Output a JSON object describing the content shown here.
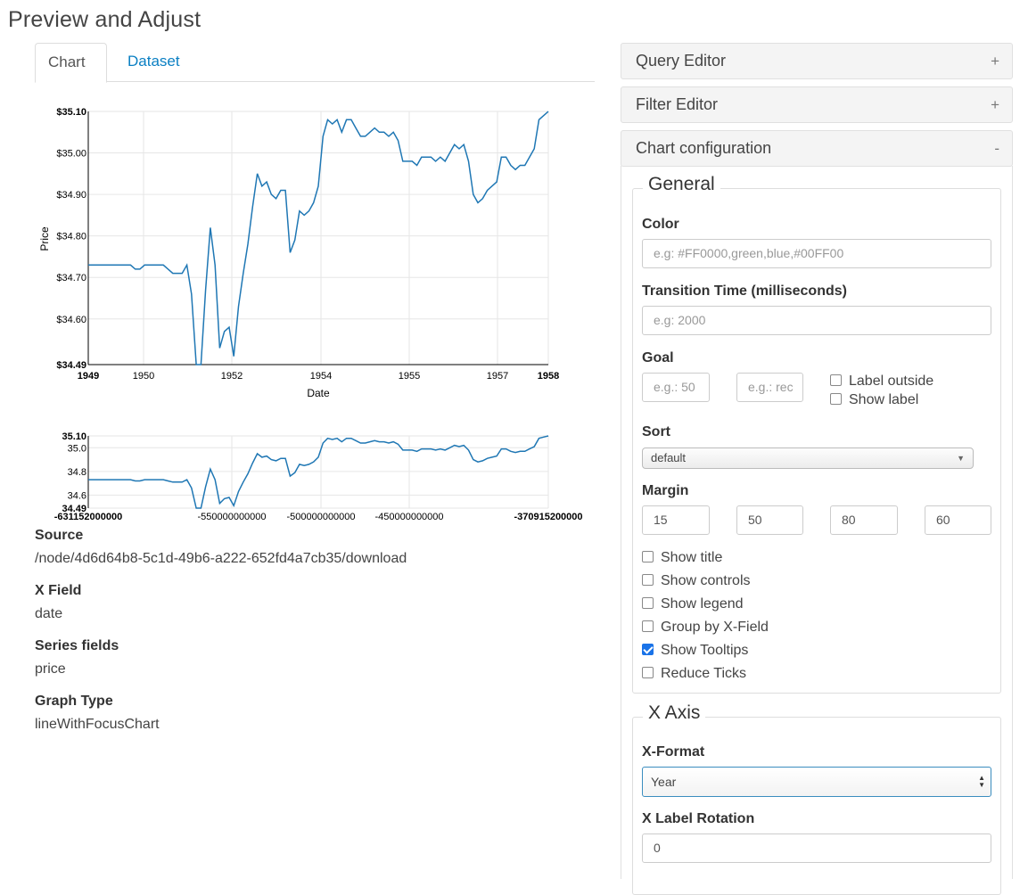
{
  "page_title": "Preview and Adjust",
  "tabs": {
    "chart": "Chart",
    "dataset": "Dataset"
  },
  "info": {
    "source_label": "Source",
    "source_value": "/node/4d6d64b8-5c1d-49b6-a222-652fd4a7cb35/download",
    "xfield_label": "X Field",
    "xfield_value": "date",
    "series_label": "Series fields",
    "series_value": "price",
    "graph_label": "Graph Type",
    "graph_value": "lineWithFocusChart"
  },
  "panels": {
    "query": {
      "title": "Query Editor",
      "toggle": "+"
    },
    "filter": {
      "title": "Filter Editor",
      "toggle": "+"
    },
    "chartcfg": {
      "title": "Chart configuration",
      "toggle": "-"
    }
  },
  "general": {
    "legend": "General",
    "color_label": "Color",
    "color_placeholder": "e.g: #FF0000,green,blue,#00FF00",
    "transition_label": "Transition Time (milliseconds)",
    "transition_placeholder": "e.g: 2000",
    "goal_label": "Goal",
    "goal_placeholder_1": "e.g.: 50",
    "goal_placeholder_2": "e.g.: rec",
    "label_outside": "Label outside",
    "show_label": "Show label",
    "sort_label": "Sort",
    "sort_value": "default",
    "margin_label": "Margin",
    "margins": [
      "15",
      "50",
      "80",
      "60"
    ],
    "options": [
      {
        "label": "Show title",
        "checked": false
      },
      {
        "label": "Show controls",
        "checked": false
      },
      {
        "label": "Show legend",
        "checked": false
      },
      {
        "label": "Group by X-Field",
        "checked": false
      },
      {
        "label": "Show Tooltips",
        "checked": true
      },
      {
        "label": "Reduce Ticks",
        "checked": false
      }
    ]
  },
  "xaxis": {
    "legend": "X Axis",
    "format_label": "X-Format",
    "format_value": "Year",
    "rotation_label": "X Label Rotation",
    "rotation_value": "0"
  },
  "colors": {
    "line": "#1f77b4",
    "link": "#0a7fc3",
    "check": "#1a73e8"
  },
  "chart_data": [
    {
      "type": "line",
      "role": "main",
      "xlabel": "Date",
      "ylabel": "Price",
      "x_ticks": [
        "1949",
        "1950",
        "1952",
        "1954",
        "1955",
        "1957",
        "1958"
      ],
      "y_ticks": [
        "$35.10",
        "$35.00",
        "$34.90",
        "$34.80",
        "$34.70",
        "$34.60",
        "$34.49"
      ],
      "ylim": [
        34.49,
        35.1
      ],
      "grid": true,
      "series": [
        {
          "values": [
            34.73,
            34.73,
            34.73,
            34.73,
            34.73,
            34.73,
            34.73,
            34.73,
            34.73,
            34.73,
            34.72,
            34.72,
            34.73,
            34.73,
            34.73,
            34.73,
            34.73,
            34.72,
            34.71,
            34.71,
            34.71,
            34.73,
            34.66,
            34.49,
            34.49,
            34.67,
            34.82,
            34.73,
            34.53,
            34.57,
            34.58,
            34.51,
            34.63,
            34.71,
            34.78,
            34.87,
            34.95,
            34.92,
            34.93,
            34.9,
            34.89,
            34.91,
            34.91,
            34.76,
            34.79,
            34.86,
            34.85,
            34.86,
            34.88,
            34.92,
            35.04,
            35.08,
            35.07,
            35.08,
            35.05,
            35.08,
            35.08,
            35.06,
            35.04,
            35.04,
            35.05,
            35.06,
            35.05,
            35.05,
            35.04,
            35.05,
            35.03,
            34.98,
            34.98,
            34.98,
            34.97,
            34.99,
            34.99,
            34.99,
            34.98,
            34.99,
            34.98,
            35.0,
            35.02,
            35.01,
            35.02,
            34.98,
            34.9,
            34.88,
            34.89,
            34.91,
            34.92,
            34.93,
            34.99,
            34.99,
            34.97,
            34.96,
            34.97,
            34.97,
            34.99,
            35.01,
            35.08,
            35.09,
            35.1
          ]
        }
      ]
    },
    {
      "type": "line",
      "role": "focus",
      "x_ticks": [
        "-631152000000",
        "-550000000000",
        "-500000000000",
        "-450000000000",
        "-370915200000"
      ],
      "y_ticks": [
        "35.10",
        "35.0",
        "34.8",
        "34.6",
        "34.49"
      ],
      "ylim": [
        34.49,
        35.1
      ],
      "grid": true
    }
  ]
}
